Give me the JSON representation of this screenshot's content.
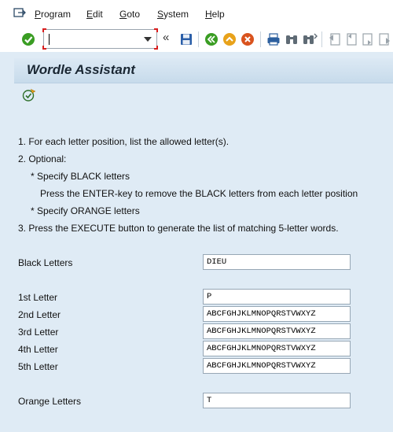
{
  "menubar": {
    "items": [
      {
        "label": "Program"
      },
      {
        "label": "Edit"
      },
      {
        "label": "Goto"
      },
      {
        "label": "System"
      },
      {
        "label": "Help"
      }
    ]
  },
  "toolbar": {
    "command_field": {
      "value": ""
    },
    "history_glyph": "«",
    "icons": [
      "enter-icon",
      "save-icon",
      "back-icon",
      "exit-icon",
      "cancel-icon",
      "print-icon",
      "find-icon",
      "find-next-icon",
      "first-page-icon",
      "previous-page-icon",
      "next-page-icon",
      "last-page-icon"
    ],
    "accent_colors": {
      "enter": "#3a9d23",
      "back": "#3a9d23",
      "exit": "#e8a21a",
      "cancel": "#d9531e",
      "save": "#2a5ea8"
    }
  },
  "screen": {
    "title": "Wordle Assistant",
    "execute_icon": "execute-icon"
  },
  "instructions": [
    "1. For each letter position, list the allowed letter(s).",
    "2. Optional:",
    "* Specify BLACK letters",
    "Press the ENTER-key to remove the BLACK letters from each letter position",
    "* Specify ORANGE letters",
    "3. Press the EXECUTE button to generate the list of matching 5-letter words."
  ],
  "fields": {
    "black": {
      "label": "Black Letters",
      "value": "DIEU"
    },
    "letter1": {
      "label": "1st Letter",
      "value": "P"
    },
    "letter2": {
      "label": "2nd Letter",
      "value": "ABCFGHJKLMNOPQRSTVWXYZ"
    },
    "letter3": {
      "label": "3rd Letter",
      "value": "ABCFGHJKLMNOPQRSTVWXYZ"
    },
    "letter4": {
      "label": "4th Letter",
      "value": "ABCFGHJKLMNOPQRSTVWXYZ"
    },
    "letter5": {
      "label": "5th Letter",
      "value": "ABCFGHJKLMNOPQRSTVWXYZ"
    },
    "orange": {
      "label": "Orange Letters",
      "value": "T"
    }
  }
}
